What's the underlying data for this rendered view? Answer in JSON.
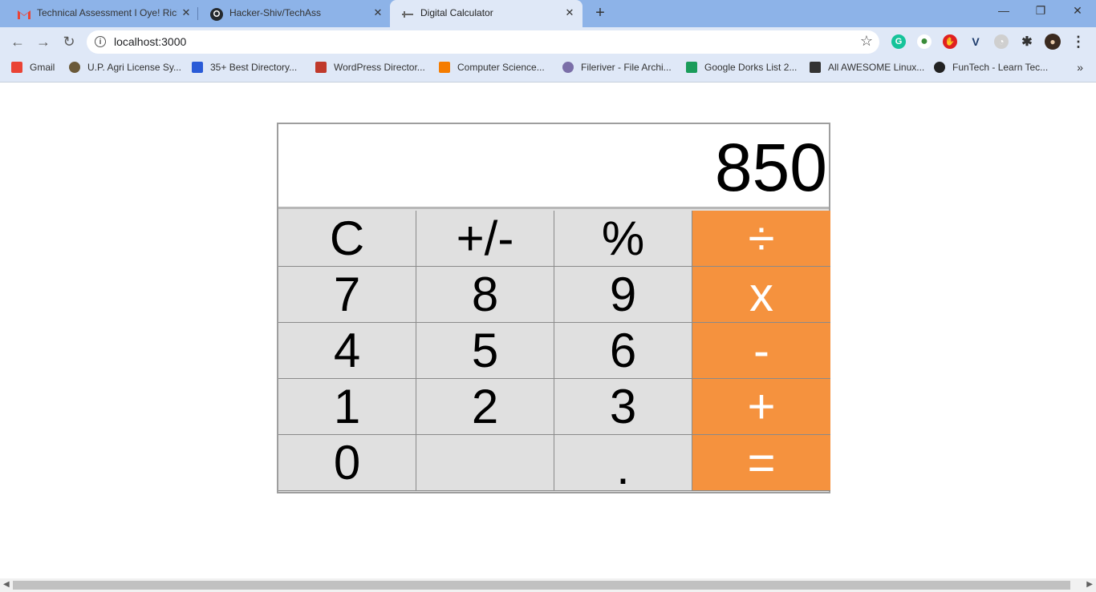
{
  "browser": {
    "tabs": [
      {
        "title": "Technical Assessment I Oye! Rick",
        "icon": "gmail-icon"
      },
      {
        "title": "Hacker-Shiv/TechAss",
        "icon": "github-icon"
      },
      {
        "title": "Digital Calculator",
        "icon": "page-icon",
        "active": true
      }
    ],
    "new_tab": "+",
    "close": "✕",
    "window_controls": {
      "minimize": "—",
      "restore": "❐",
      "close": "✕"
    },
    "nav": {
      "back": "←",
      "forward": "→",
      "reload": "↻"
    },
    "address": {
      "url": "localhost:3000",
      "info": "i",
      "star": "☆"
    },
    "extensions": [
      {
        "name": "grammarly-icon",
        "glyph": "G",
        "color": "#15c39a"
      },
      {
        "name": "globe-extension-icon",
        "glyph": "●",
        "color": "#3a8c3a"
      },
      {
        "name": "adblock-icon",
        "glyph": "✋",
        "color": "#e02020"
      },
      {
        "name": "vimeo-extension-icon",
        "glyph": "V",
        "color": "#1c3a6b"
      },
      {
        "name": "compass-extension-icon",
        "glyph": "◔",
        "color": "#9a9a9a"
      },
      {
        "name": "puzzle-extensions-icon",
        "glyph": "✱",
        "color": "#333333"
      },
      {
        "name": "profile-avatar",
        "glyph": "●",
        "color": "#3b2a1f"
      },
      {
        "name": "menu-dots-icon",
        "glyph": "⋮",
        "color": "#333333"
      }
    ],
    "bookmarks": [
      {
        "label": "Gmail",
        "color": "#ea4335"
      },
      {
        "label": "U.P. Agri License Sy...",
        "color": "#6b5a3a"
      },
      {
        "label": "35+ Best Directory...",
        "color": "#2a5bd7"
      },
      {
        "label": "WordPress Director...",
        "color": "#c0392b"
      },
      {
        "label": "Computer Science...",
        "color": "#f57c00"
      },
      {
        "label": "Fileriver - File Archi...",
        "color": "#7b6fa8"
      },
      {
        "label": "Google Dorks List 2...",
        "color": "#1a9c5a"
      },
      {
        "label": "All AWESOME Linux...",
        "color": "#333333"
      },
      {
        "label": "FunTech - Learn Tec...",
        "color": "#222222"
      }
    ],
    "bookmarks_more": "»"
  },
  "calculator": {
    "display": "850",
    "keys": [
      [
        "C",
        "+/-",
        "%",
        "÷"
      ],
      [
        "7",
        "8",
        "9",
        "x"
      ],
      [
        "4",
        "5",
        "6",
        "-"
      ],
      [
        "1",
        "2",
        "3",
        "+"
      ],
      [
        "0",
        "",
        ".",
        "="
      ]
    ],
    "operator_color": "#f5923e",
    "key_color": "#e0e0e0"
  }
}
